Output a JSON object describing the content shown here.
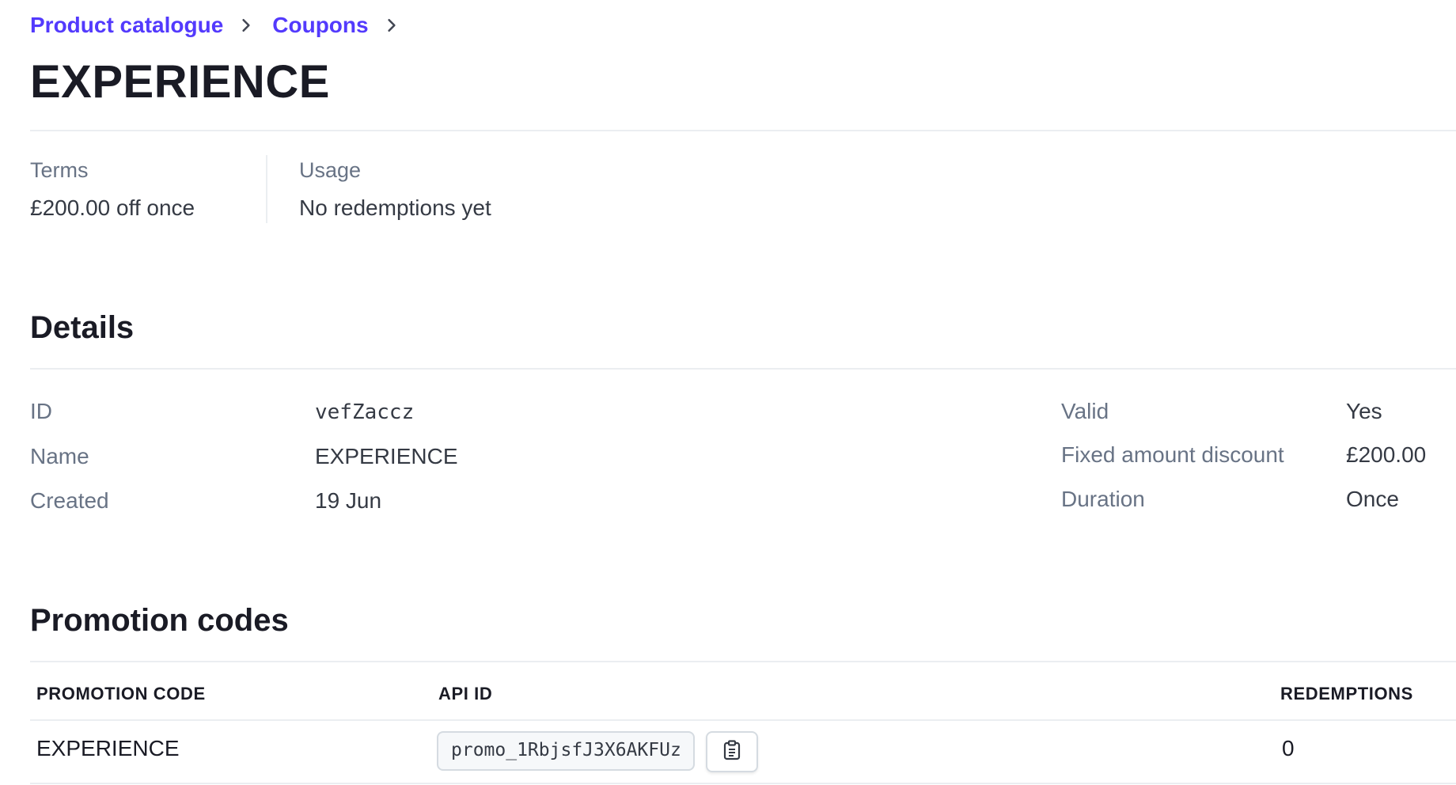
{
  "breadcrumb": {
    "items": [
      "Product catalogue",
      "Coupons"
    ]
  },
  "page_title": "EXPERIENCE",
  "summary": {
    "terms_label": "Terms",
    "terms_value": "£200.00 off once",
    "usage_label": "Usage",
    "usage_value": "No redemptions yet"
  },
  "details": {
    "title": "Details",
    "left": [
      {
        "label": "ID",
        "value": "vefZaccz"
      },
      {
        "label": "Name",
        "value": "EXPERIENCE"
      },
      {
        "label": "Created",
        "value": "19 Jun"
      }
    ],
    "right": [
      {
        "label": "Valid",
        "value": "Yes"
      },
      {
        "label": "Fixed amount discount",
        "value": "£200.00"
      },
      {
        "label": "Duration",
        "value": "Once"
      }
    ]
  },
  "promotion_codes": {
    "title": "Promotion codes",
    "columns": [
      "PROMOTION CODE",
      "API ID",
      "REDEMPTIONS"
    ],
    "rows": [
      {
        "code": "EXPERIENCE",
        "api_id": "promo_1RbjsfJ3X6AKFUz",
        "redemptions": "0"
      }
    ]
  },
  "icons": {
    "breadcrumb_separator": "chevron-right-icon",
    "copy": "clipboard-icon"
  },
  "colors": {
    "link": "#533afd",
    "label": "#687385",
    "divider": "#ebeef1"
  }
}
